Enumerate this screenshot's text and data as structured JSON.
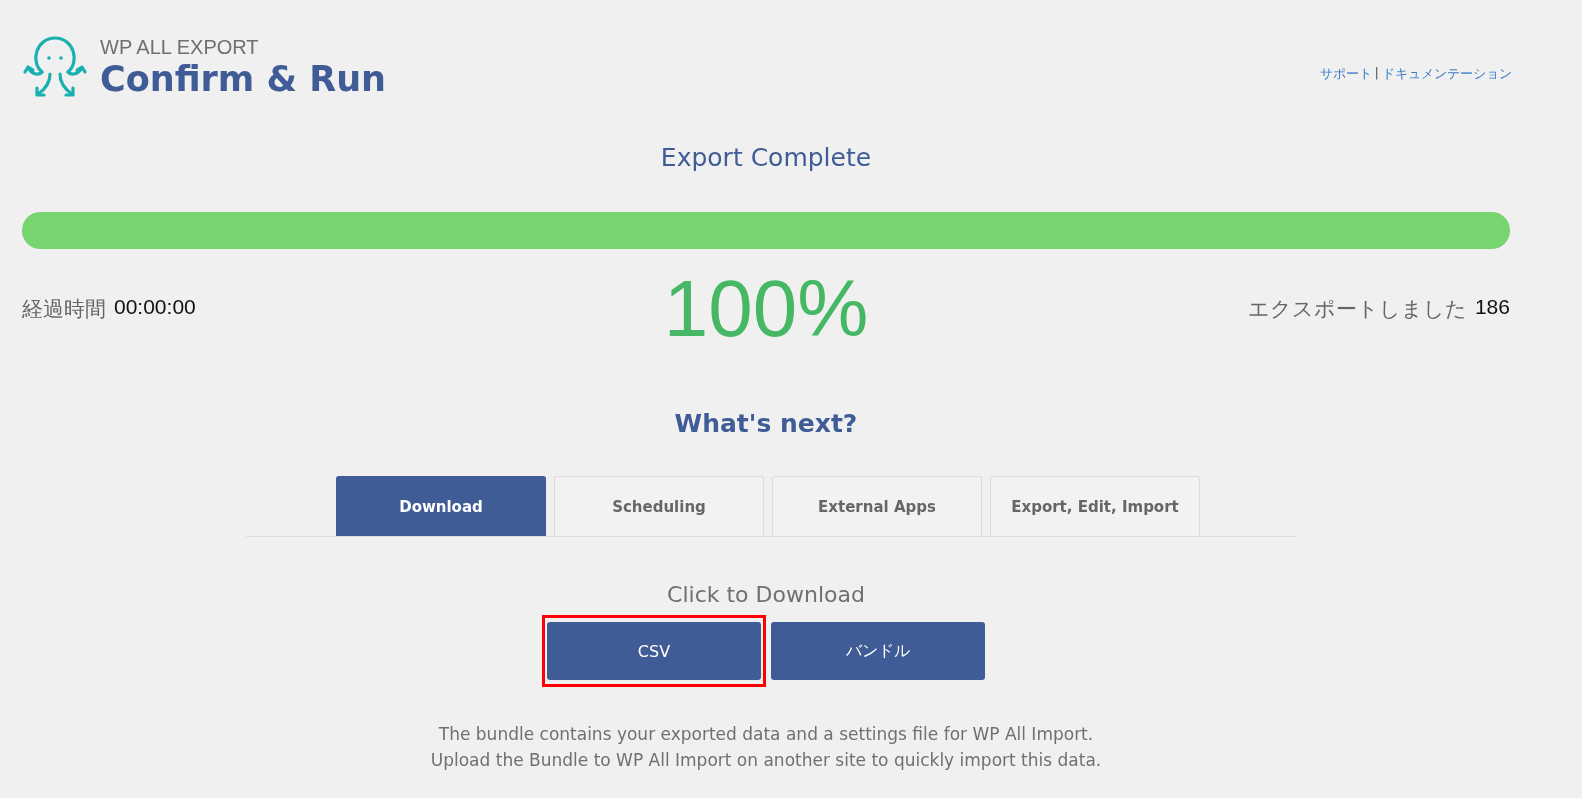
{
  "header": {
    "brand": "WP ALL EXPORT",
    "title": "Confirm & Run",
    "links": [
      {
        "label": "サポート"
      },
      {
        "label": "ドキュメンテーション"
      }
    ],
    "link_separator": "|"
  },
  "status": {
    "title": "Export Complete",
    "level": 1.0,
    "elapsed_label": "経過時間",
    "elapsed": "00:00:00",
    "percent": "100%",
    "exported_label": "エクスポートしました",
    "exported": "186"
  },
  "next": {
    "title": "What's next?",
    "tabs": [
      {
        "label": "Download",
        "selected": true
      },
      {
        "label": "Scheduling",
        "selected": false
      },
      {
        "label": "External Apps",
        "selected": false
      },
      {
        "label": "Export, Edit, Import",
        "selected": false
      }
    ],
    "download_title": "Click to Download",
    "buttons": [
      {
        "label": "CSV",
        "highlighted": true
      },
      {
        "label": "バンドル",
        "highlighted": false
      }
    ],
    "notes": [
      "The bundle contains your exported data and a settings file for WP All Import.",
      "Upload the Bundle to WP All Import on another site to quickly import this data."
    ]
  }
}
